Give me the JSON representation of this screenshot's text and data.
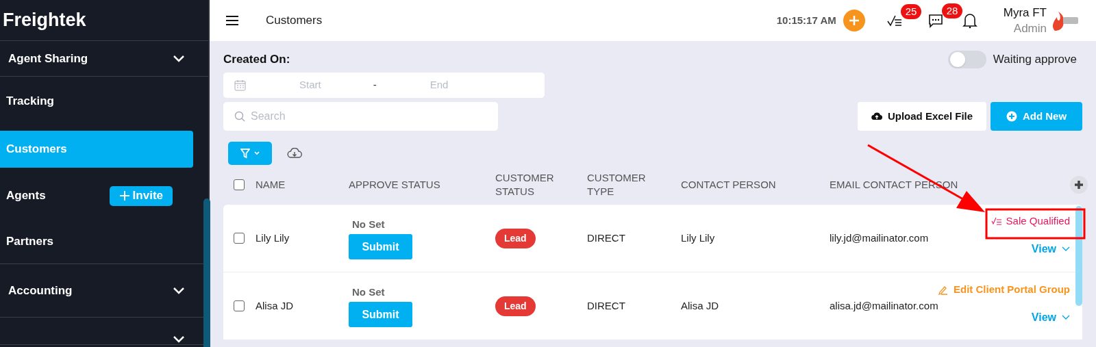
{
  "sidebar": {
    "brand": "Freightek",
    "items": [
      {
        "label": "Agent Sharing",
        "kind": "group",
        "selected": false
      },
      {
        "label": "Tracking",
        "kind": "link",
        "selected": false
      },
      {
        "label": "Customers",
        "kind": "link",
        "selected": true
      },
      {
        "label": "Agents",
        "kind": "invite",
        "selected": false,
        "action": "Invite"
      },
      {
        "label": "Partners",
        "kind": "link",
        "selected": false
      },
      {
        "label": "Accounting",
        "kind": "group",
        "selected": false
      },
      {
        "kind": "group",
        "selected": false
      }
    ]
  },
  "header": {
    "page_title": "Customers",
    "time": "10:15:17 AM",
    "tasks_count": "25",
    "messages_count": "28",
    "user_name": "Myra FT",
    "user_role": "Admin"
  },
  "filters": {
    "created_on_label": "Created On:",
    "start_placeholder": "Start",
    "separator": "-",
    "end_placeholder": "End",
    "search_placeholder": "Search",
    "waiting_toggle": {
      "label": "Waiting approve",
      "on": false
    },
    "upload_button": "Upload Excel File",
    "add_button": "Add New"
  },
  "table": {
    "all_checked": false,
    "columns": [
      "NAME",
      "APPROVE STATUS",
      "CUSTOMER STATUS",
      "CUSTOMER TYPE",
      "CONTACT PERSON",
      "EMAIL CONTACT PERSON"
    ],
    "rows": [
      {
        "checked": false,
        "name": "Lily Lily",
        "approve_status": "No Set",
        "approve_button": "Submit",
        "customer_status": "Lead",
        "type": "DIRECT",
        "contact": "Lily Lily",
        "email": "lily.jd@mailinator.com",
        "action": {
          "kind": "sale_qualified",
          "label": "Sale Qualified"
        },
        "view": "View"
      },
      {
        "checked": false,
        "name": "Alisa JD",
        "approve_status": "No Set",
        "approve_button": "Submit",
        "customer_status": "Lead",
        "type": "DIRECT",
        "contact": "Alisa JD",
        "email": "alisa.jd@mailinator.com",
        "action": {
          "kind": "edit_portal",
          "label": "Edit Client Portal Group"
        },
        "view": "View"
      }
    ]
  },
  "annotation": {
    "kind": "arrow_to_box"
  }
}
